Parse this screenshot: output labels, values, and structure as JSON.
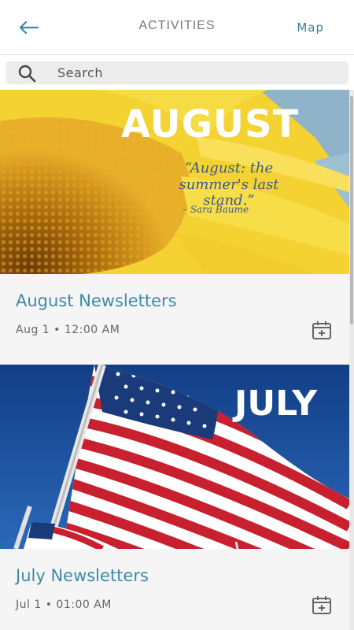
{
  "header": {
    "title": "ACTIVITIES",
    "map_label": "Map"
  },
  "search": {
    "placeholder": "Search"
  },
  "cards": [
    {
      "image_text": "AUGUST",
      "quote": "“August: the summer's last stand.”",
      "quote_author": "– Sara Baume",
      "title": "August Newsletters",
      "date": "Aug 1 • 12:00 AM"
    },
    {
      "image_text": "JULY",
      "title": "July Newsletters",
      "date": "Jul 1 • 01:00 AM"
    }
  ],
  "colors": {
    "accent": "#3d8aa6",
    "sunflower_yellow": "#f5d52a",
    "sky_blue": "#1f4f9a"
  }
}
